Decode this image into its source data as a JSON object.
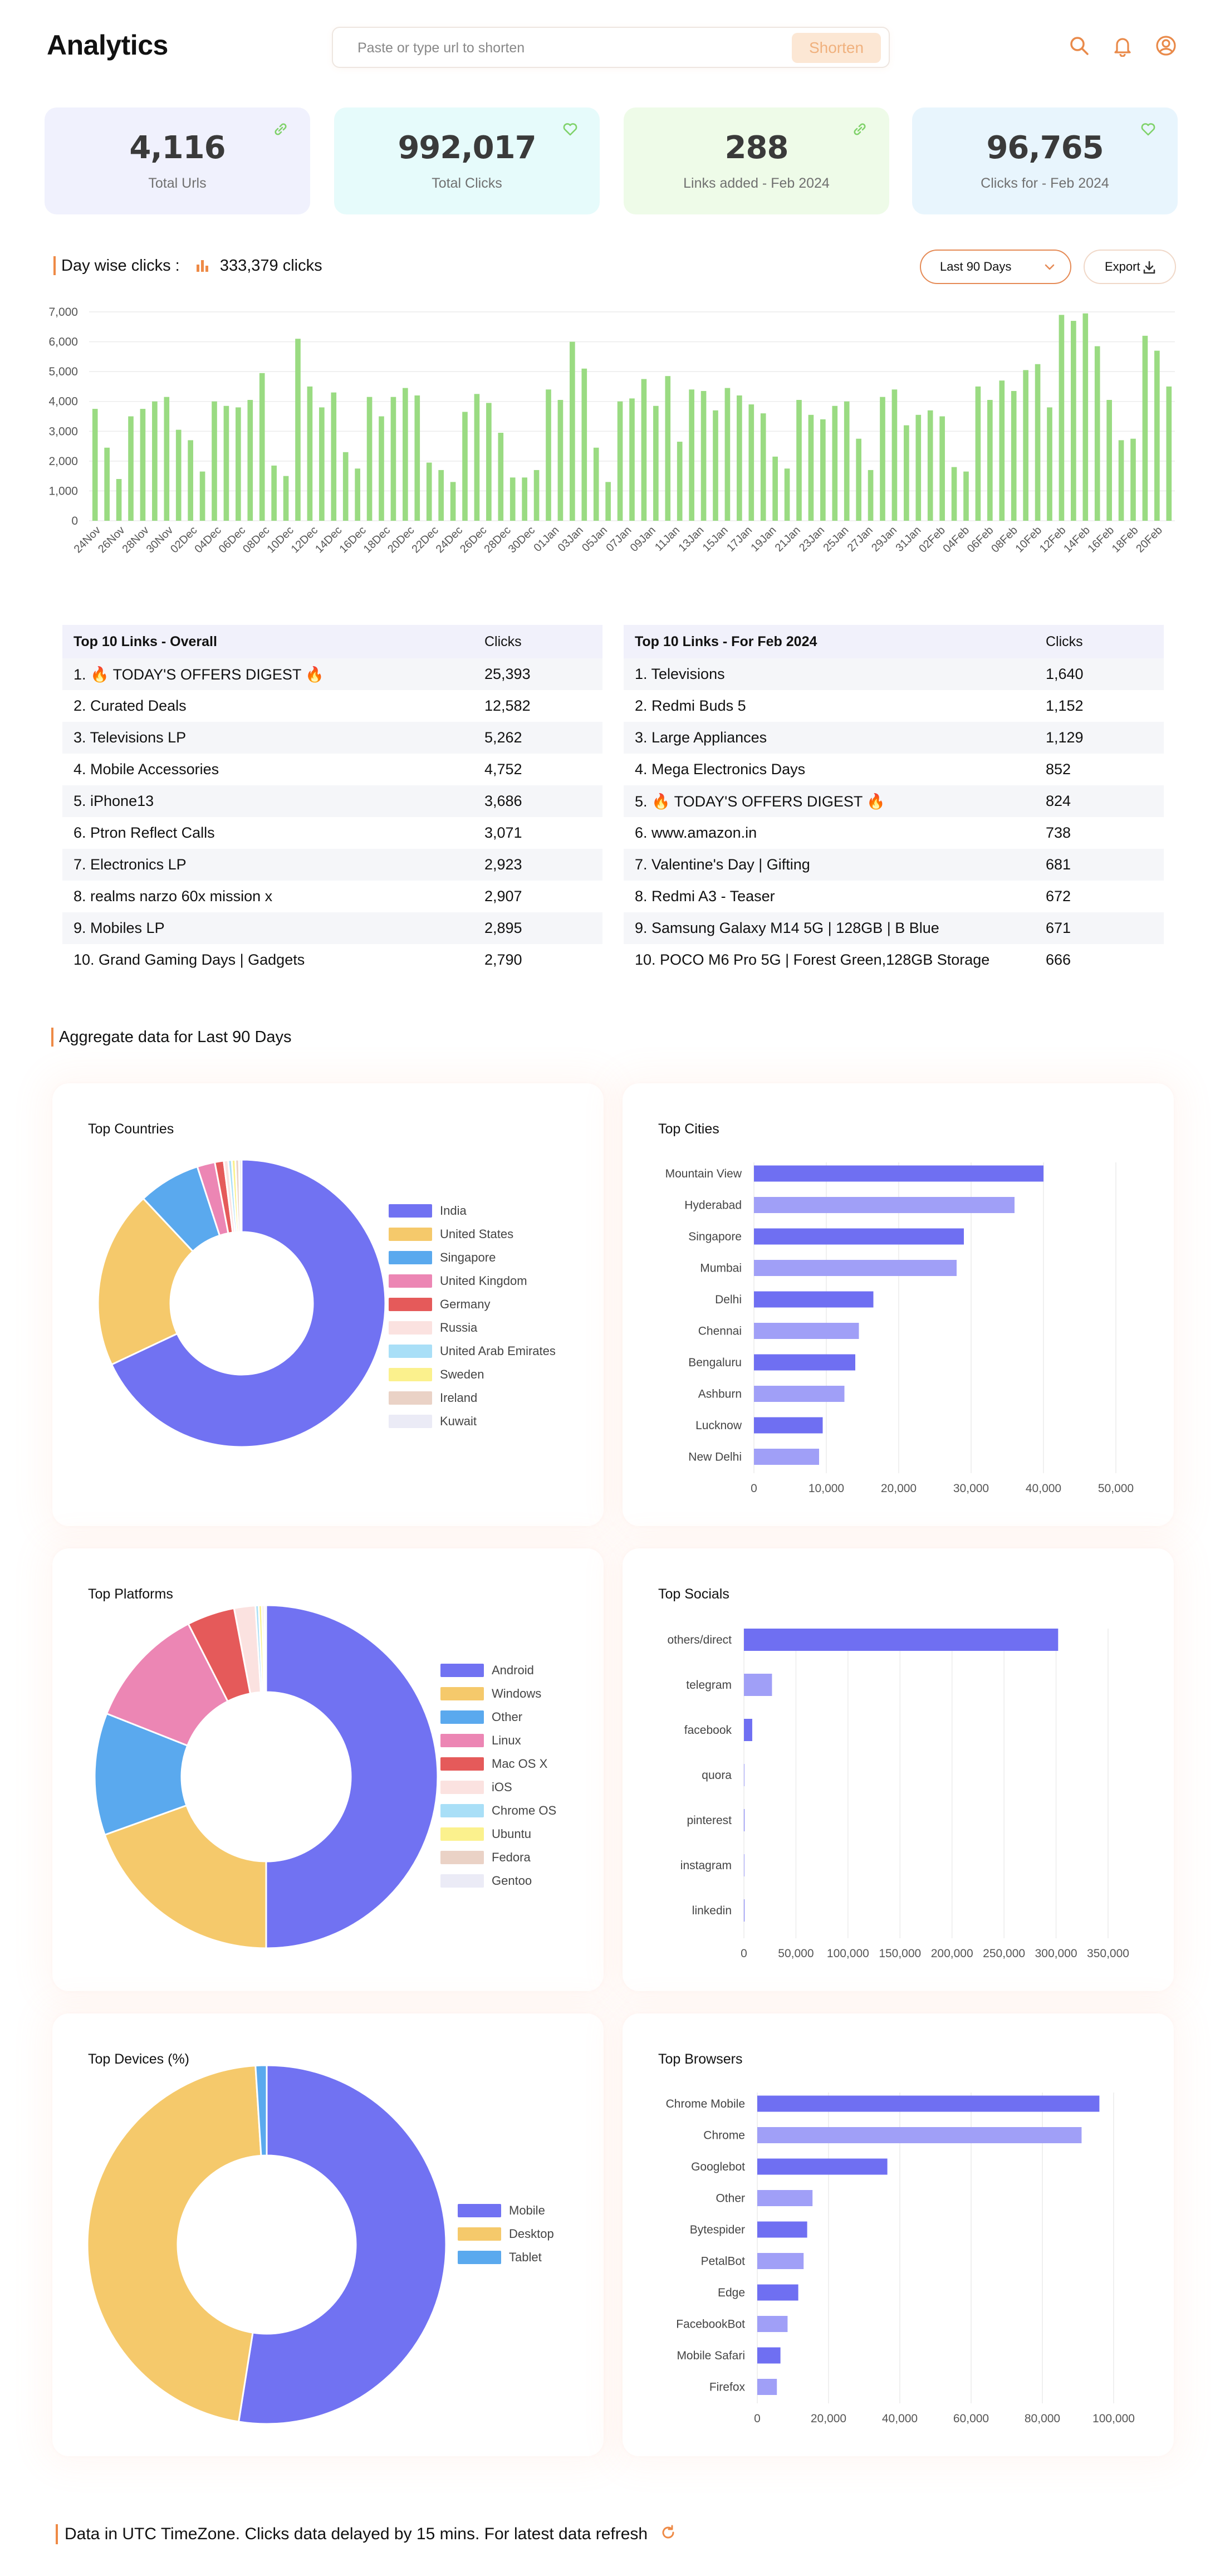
{
  "header": {
    "title": "Analytics",
    "url_placeholder": "Paste or type url to shorten",
    "shorten_label": "Shorten",
    "icons": [
      "search-icon",
      "bell-icon",
      "user-icon"
    ]
  },
  "stats": [
    {
      "value": "4,116",
      "label": "Total Urls",
      "bg": "#f0f1fd",
      "icon": "link-icon"
    },
    {
      "value": "992,017",
      "label": "Total Clicks",
      "bg": "#e6fbfb",
      "icon": "heart-icon"
    },
    {
      "value": "288",
      "label": "Links added - Feb 2024",
      "bg": "#eefbe8",
      "icon": "link-icon"
    },
    {
      "value": "96,765",
      "label": "Clicks for - Feb 2024",
      "bg": "#e8f5fd",
      "icon": "heart-icon"
    }
  ],
  "daywise": {
    "title": "Day wise clicks :",
    "total": "333,379 clicks",
    "range_label": "Last 90 Days",
    "export_label": "Export"
  },
  "chart_data": [
    {
      "type": "bar",
      "title": "",
      "ylim": [
        0,
        7000
      ],
      "yticks": [
        "0",
        "1,000",
        "2,000",
        "3,000",
        "4,000",
        "5,000",
        "6,000",
        "7,000"
      ],
      "color": "#9adb82",
      "x_labels": [
        "24Nov",
        "26Nov",
        "28Nov",
        "30Nov",
        "02Dec",
        "04Dec",
        "06Dec",
        "08Dec",
        "10Dec",
        "12Dec",
        "14Dec",
        "16Dec",
        "18Dec",
        "20Dec",
        "22Dec",
        "24Dec",
        "26Dec",
        "28Dec",
        "30Dec",
        "01Jan",
        "03Jan",
        "05Jan",
        "07Jan",
        "09Jan",
        "11Jan",
        "13Jan",
        "15Jan",
        "17Jan",
        "19Jan",
        "21Jan",
        "23Jan",
        "25Jan",
        "27Jan",
        "29Jan",
        "31Jan",
        "02Feb",
        "04Feb",
        "06Feb",
        "08Feb",
        "10Feb",
        "12Feb",
        "14Feb",
        "16Feb",
        "18Feb",
        "20Feb"
      ],
      "values": [
        3750,
        2450,
        1400,
        3500,
        3750,
        4000,
        4150,
        3050,
        2700,
        1650,
        4000,
        3850,
        3800,
        4050,
        4950,
        1850,
        1500,
        6100,
        4500,
        3800,
        4300,
        2300,
        1750,
        4150,
        3500,
        4150,
        4450,
        4200,
        1950,
        1700,
        1300,
        3650,
        4250,
        3950,
        2950,
        1450,
        1450,
        1700,
        4400,
        4050,
        6000,
        5100,
        2450,
        1300,
        4000,
        4100,
        4750,
        3850,
        4850,
        2650,
        4400,
        4350,
        3700,
        4450,
        4200,
        3900,
        3600,
        2150,
        1750,
        4050,
        3550,
        3400,
        3850,
        4000,
        2750,
        1700,
        4150,
        4400,
        3200,
        3550,
        3700,
        3500,
        1800,
        1650,
        4500,
        4050,
        4700,
        4350,
        5050,
        5250,
        3800,
        6900,
        6700,
        6950,
        5850,
        4050,
        2700,
        2750,
        6200,
        5700,
        4500
      ]
    },
    {
      "type": "pie",
      "title": "Top Countries",
      "labels": [
        "India",
        "United States",
        "Singapore",
        "United Kingdom",
        "Germany",
        "Russia",
        "United Arab Emirates",
        "Sweden",
        "Ireland",
        "Kuwait"
      ],
      "values": [
        68,
        20,
        7,
        2,
        1,
        0.5,
        0.4,
        0.4,
        0.4,
        0.3
      ],
      "colors": [
        "#7172f2",
        "#f5c96b",
        "#5aa9ee",
        "#ec86b4",
        "#e55a5a",
        "#fbe2e0",
        "#a9dff7",
        "#fbf18d",
        "#ead2c6",
        "#ebebf6"
      ]
    },
    {
      "type": "bar",
      "orientation": "horizontal",
      "title": "Top Cities",
      "categories": [
        "Mountain View",
        "Hyderabad",
        "Singapore",
        "Mumbai",
        "Delhi",
        "Chennai",
        "Bengaluru",
        "Ashburn",
        "Lucknow",
        "New Delhi"
      ],
      "values": [
        40000,
        36000,
        29000,
        28000,
        16500,
        14500,
        14000,
        12500,
        9500,
        9000
      ],
      "xlim": [
        0,
        50000
      ],
      "xticks": [
        "0",
        "10,000",
        "20,000",
        "30,000",
        "40,000",
        "50,000"
      ],
      "colors": [
        "#6f6ff2",
        "#a09ff7"
      ]
    },
    {
      "type": "pie",
      "title": "Top Platforms",
      "labels": [
        "Android",
        "Windows",
        "Other",
        "Linux",
        "Mac OS X",
        "iOS",
        "Chrome OS",
        "Ubuntu",
        "Fedora",
        "Gentoo"
      ],
      "values": [
        50,
        19.5,
        11.5,
        11.5,
        4.5,
        2,
        0.3,
        0.3,
        0.2,
        0.2
      ],
      "colors": [
        "#7172f2",
        "#f5c96b",
        "#5aa9ee",
        "#ec86b4",
        "#e55a5a",
        "#fbe2e0",
        "#a9dff7",
        "#fbf18d",
        "#ead2c6",
        "#ebebf6"
      ]
    },
    {
      "type": "bar",
      "orientation": "horizontal",
      "title": "Top Socials",
      "categories": [
        "others/direct",
        "telegram",
        "facebook",
        "quora",
        "pinterest",
        "instagram",
        "linkedin"
      ],
      "values": [
        302000,
        27000,
        8000,
        500,
        500,
        300,
        200
      ],
      "xlim": [
        0,
        350000
      ],
      "xticks": [
        "0",
        "50,000",
        "100,000",
        "150,000",
        "200,000",
        "250,000",
        "300,000",
        "350,000"
      ],
      "colors": [
        "#6f6ff2",
        "#a09ff7"
      ]
    },
    {
      "type": "pie",
      "title": "Top Devices (%)",
      "labels": [
        "Mobile",
        "Desktop",
        "Tablet"
      ],
      "values": [
        52.5,
        46.5,
        1
      ],
      "colors": [
        "#7172f2",
        "#f5c96b",
        "#5aa9ee"
      ]
    },
    {
      "type": "bar",
      "orientation": "horizontal",
      "title": "Top Browsers",
      "categories": [
        "Chrome Mobile",
        "Chrome",
        "Googlebot",
        "Other",
        "Bytespider",
        "PetalBot",
        "Edge",
        "FacebookBot",
        "Mobile Safari",
        "Firefox"
      ],
      "values": [
        96000,
        91000,
        36500,
        15500,
        14000,
        13000,
        11500,
        8500,
        6500,
        5500
      ],
      "xlim": [
        0,
        100000
      ],
      "xticks": [
        "0",
        "20,000",
        "40,000",
        "60,000",
        "80,000",
        "100,000"
      ],
      "colors": [
        "#6f6ff2",
        "#a09ff7"
      ]
    }
  ],
  "tables": {
    "overall": {
      "title": "Top 10 Links - Overall",
      "clicks_header": "Clicks",
      "rows": [
        {
          "name": "1. 🔥 TODAY'S OFFERS DIGEST 🔥",
          "clicks": "25,393"
        },
        {
          "name": "2. Curated Deals",
          "clicks": "12,582"
        },
        {
          "name": "3. Televisions LP",
          "clicks": "5,262"
        },
        {
          "name": "4. Mobile Accessories",
          "clicks": "4,752"
        },
        {
          "name": "5. iPhone13",
          "clicks": "3,686"
        },
        {
          "name": "6. Ptron Reflect Calls",
          "clicks": "3,071"
        },
        {
          "name": "7. Electronics LP",
          "clicks": "2,923"
        },
        {
          "name": "8. realms narzo 60x mission x",
          "clicks": "2,907"
        },
        {
          "name": "9. Mobiles LP",
          "clicks": "2,895"
        },
        {
          "name": "10. Grand Gaming Days | Gadgets",
          "clicks": "2,790"
        }
      ]
    },
    "feb": {
      "title": "Top 10 Links - For Feb 2024",
      "clicks_header": "Clicks",
      "rows": [
        {
          "name": "1. Televisions",
          "clicks": "1,640"
        },
        {
          "name": "2. Redmi Buds 5",
          "clicks": "1,152"
        },
        {
          "name": "3. Large Appliances",
          "clicks": "1,129"
        },
        {
          "name": "4. Mega Electronics Days",
          "clicks": "852"
        },
        {
          "name": "5. 🔥 TODAY'S OFFERS DIGEST 🔥",
          "clicks": "824"
        },
        {
          "name": "6. www.amazon.in",
          "clicks": "738"
        },
        {
          "name": "7. Valentine's Day | Gifting",
          "clicks": "681"
        },
        {
          "name": "8. Redmi A3 - Teaser",
          "clicks": "672"
        },
        {
          "name": "9. Samsung Galaxy M14 5G | 128GB | B Blue",
          "clicks": "671"
        },
        {
          "name": "10. POCO M6 Pro 5G | Forest Green,128GB Storage",
          "clicks": "666"
        }
      ]
    }
  },
  "aggregate_title": "Aggregate data for Last 90 Days",
  "footer_note": "Data in UTC TimeZone. Clicks data delayed by 15 mins. For latest data refresh",
  "colors": {
    "accent": "#ee8a46",
    "primary": "#7172f2"
  }
}
